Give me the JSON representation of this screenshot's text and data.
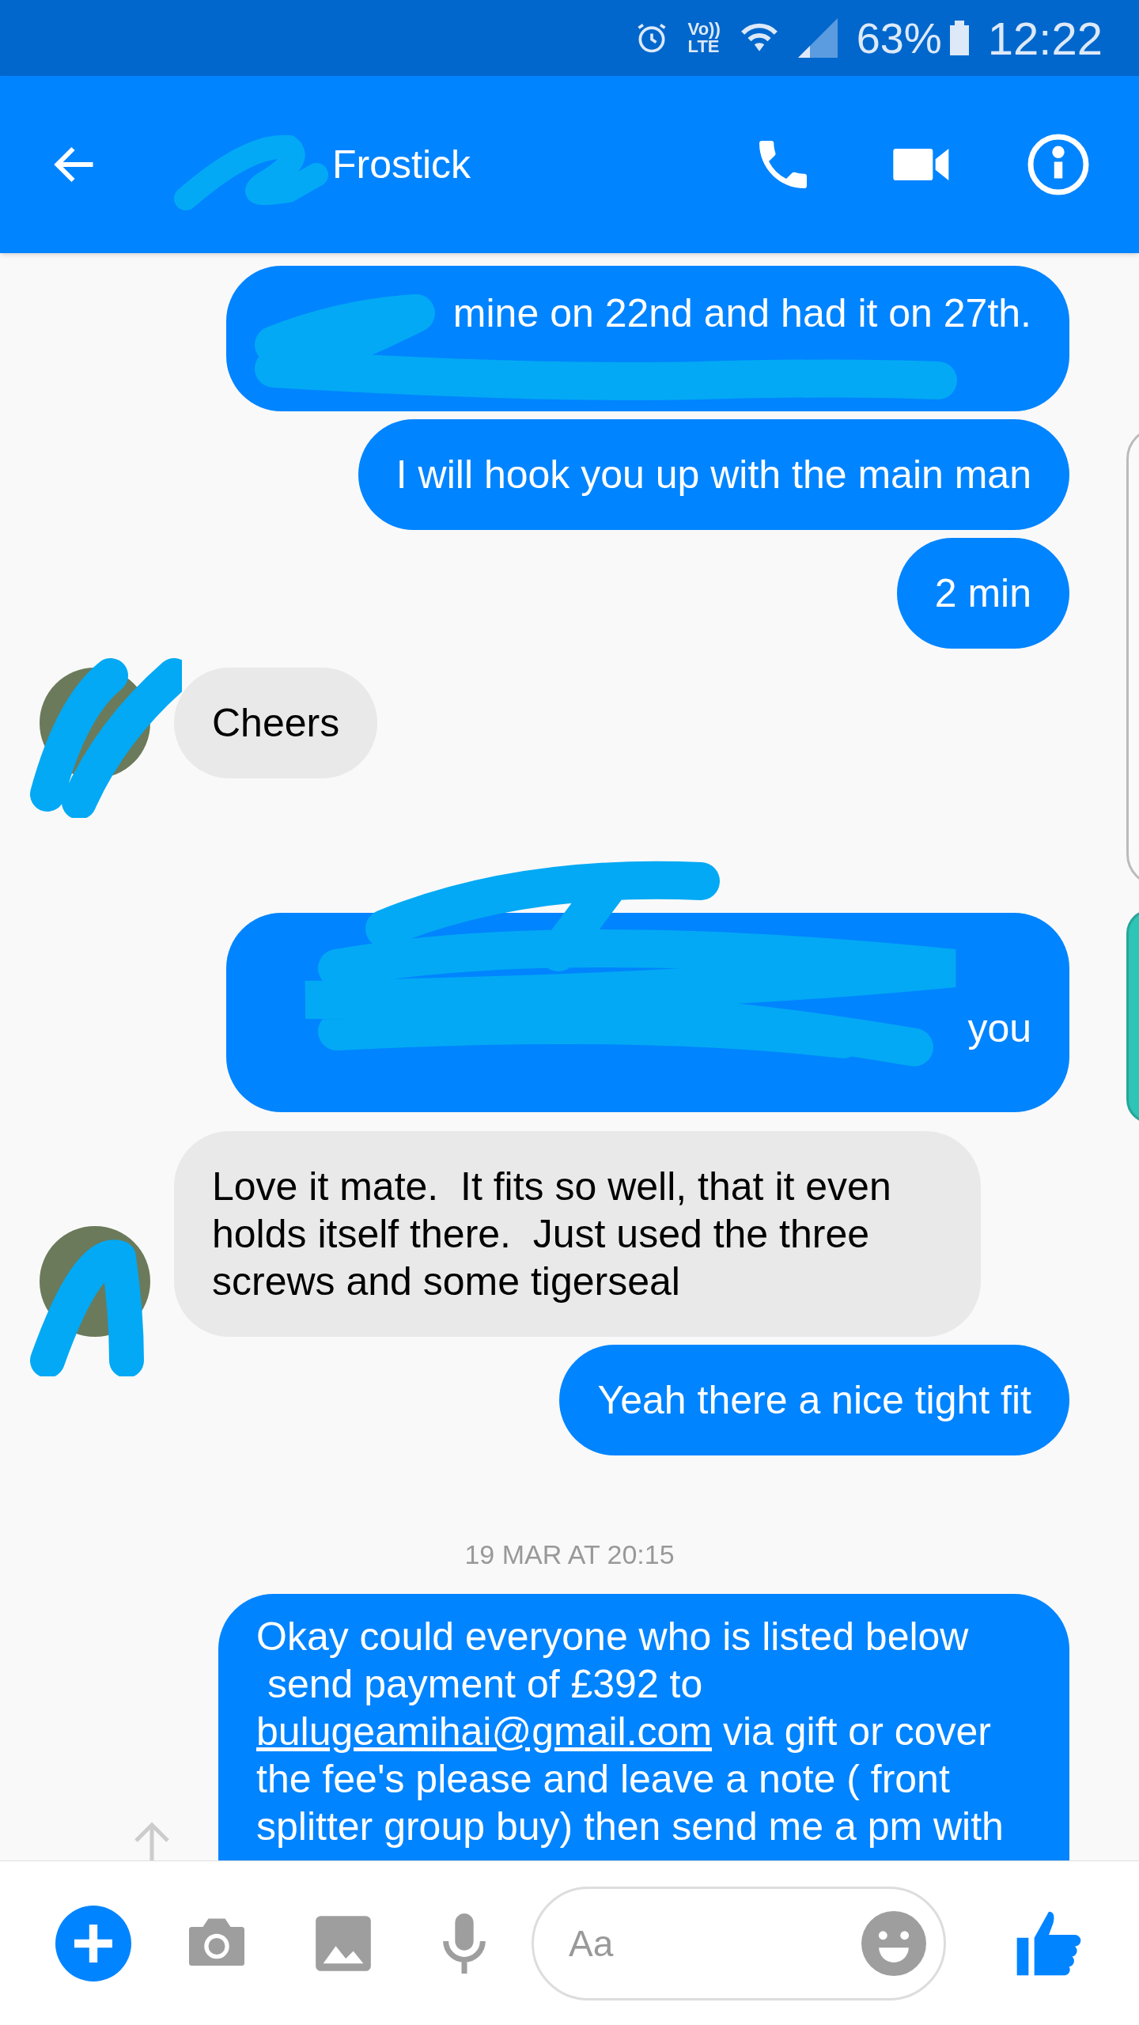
{
  "status_bar": {
    "network_badge": [
      "Vo))",
      "LTE"
    ],
    "battery": "63%",
    "time": "12:22"
  },
  "header": {
    "title": "Frostick"
  },
  "messages": [
    {
      "kind": "redacted_outgoing",
      "visible_text": "mine on 22nd and had it on 27th."
    },
    {
      "kind": "outgoing",
      "text": "I will hook you up with the main man"
    },
    {
      "kind": "outgoing",
      "text": "2 min"
    },
    {
      "kind": "incoming",
      "text": "Cheers"
    },
    {
      "kind": "redacted_outgoing",
      "visible_text": "you"
    },
    {
      "kind": "incoming",
      "text": "Love it mate.  It fits so well, that it even holds itself there.  Just used the three screws and some tigerseal"
    },
    {
      "kind": "outgoing",
      "text": "Yeah there a nice tight fit"
    },
    {
      "kind": "timestamp",
      "text": "19 MAR AT 20:15"
    },
    {
      "kind": "outgoing_link",
      "before": "Okay could everyone who is listed below\n send payment of £392 to",
      "link": "bulugeamihai@gmail.com",
      "after": "via gift or cover the fee's please and leave a note ( front splitter group buy) then send me a pm with"
    }
  ],
  "composer": {
    "placeholder": "Aa"
  }
}
